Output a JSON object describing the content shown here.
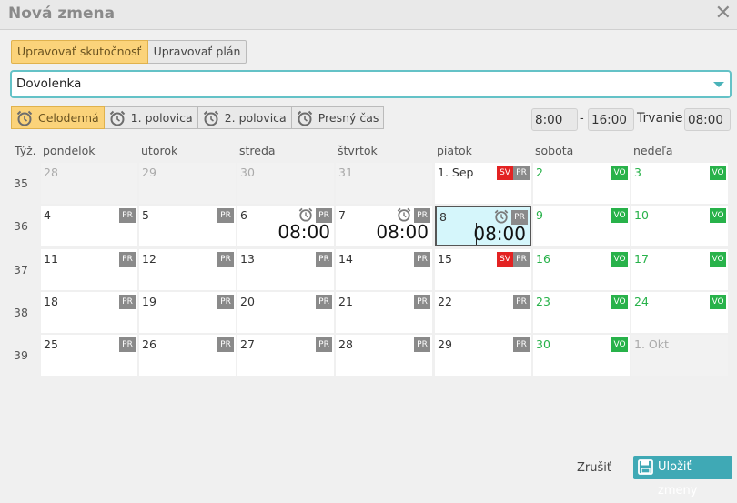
{
  "dialog": {
    "title": "Nová zmena"
  },
  "tabs": [
    {
      "label": "Upravovať skutočnosť",
      "active": true
    },
    {
      "label": "Upravovať plán",
      "active": false
    }
  ],
  "shift_type": {
    "value": "Dovolenka"
  },
  "modes": [
    {
      "label": "Celodenná",
      "active": true
    },
    {
      "label": "1. polovica",
      "active": false
    },
    {
      "label": "2. polovica",
      "active": false
    },
    {
      "label": "Presný čas",
      "active": false
    }
  ],
  "time": {
    "start": "8:00",
    "separator": "-",
    "end": "16:00",
    "duration_label": "Trvanie",
    "duration": "08:00"
  },
  "calendar": {
    "week_header": "Týž.",
    "day_headers": [
      "pondelok",
      "utorok",
      "streda",
      "štvrtok",
      "piatok",
      "sobota",
      "nedeľa"
    ],
    "weeks": [
      {
        "num": "35",
        "days": [
          {
            "d": "28",
            "type": "other"
          },
          {
            "d": "29",
            "type": "other"
          },
          {
            "d": "30",
            "type": "other"
          },
          {
            "d": "31",
            "type": "other"
          },
          {
            "d": "1. Sep",
            "badges": [
              "SV",
              "PR"
            ]
          },
          {
            "d": "2",
            "type": "weekend",
            "badges": [
              "VO"
            ]
          },
          {
            "d": "3",
            "type": "weekend",
            "badges": [
              "VO"
            ]
          }
        ]
      },
      {
        "num": "36",
        "days": [
          {
            "d": "4",
            "badges": [
              "PR"
            ]
          },
          {
            "d": "5",
            "badges": [
              "PR"
            ]
          },
          {
            "d": "6",
            "badges": [
              "PR"
            ],
            "clock": true,
            "time": "08:00"
          },
          {
            "d": "7",
            "badges": [
              "PR"
            ],
            "clock": true,
            "time": "08:00"
          },
          {
            "d": "8",
            "badges": [
              "PR"
            ],
            "clock": true,
            "time": "08:00",
            "selected": true
          },
          {
            "d": "9",
            "type": "weekend",
            "badges": [
              "VO"
            ]
          },
          {
            "d": "10",
            "type": "weekend",
            "badges": [
              "VO"
            ]
          }
        ]
      },
      {
        "num": "37",
        "days": [
          {
            "d": "11",
            "badges": [
              "PR"
            ]
          },
          {
            "d": "12",
            "badges": [
              "PR"
            ]
          },
          {
            "d": "13",
            "badges": [
              "PR"
            ]
          },
          {
            "d": "14",
            "badges": [
              "PR"
            ]
          },
          {
            "d": "15",
            "badges": [
              "SV",
              "PR"
            ]
          },
          {
            "d": "16",
            "type": "weekend",
            "badges": [
              "VO"
            ]
          },
          {
            "d": "17",
            "type": "weekend",
            "badges": [
              "VO"
            ]
          }
        ]
      },
      {
        "num": "38",
        "days": [
          {
            "d": "18",
            "badges": [
              "PR"
            ]
          },
          {
            "d": "19",
            "badges": [
              "PR"
            ]
          },
          {
            "d": "20",
            "badges": [
              "PR"
            ]
          },
          {
            "d": "21",
            "badges": [
              "PR"
            ]
          },
          {
            "d": "22",
            "badges": [
              "PR"
            ]
          },
          {
            "d": "23",
            "type": "weekend",
            "badges": [
              "VO"
            ]
          },
          {
            "d": "24",
            "type": "weekend",
            "badges": [
              "VO"
            ]
          }
        ]
      },
      {
        "num": "39",
        "days": [
          {
            "d": "25",
            "badges": [
              "PR"
            ]
          },
          {
            "d": "26",
            "badges": [
              "PR"
            ]
          },
          {
            "d": "27",
            "badges": [
              "PR"
            ]
          },
          {
            "d": "28",
            "badges": [
              "PR"
            ]
          },
          {
            "d": "29",
            "badges": [
              "PR"
            ]
          },
          {
            "d": "30",
            "type": "weekend",
            "badges": [
              "VO"
            ]
          },
          {
            "d": "1. Okt",
            "type": "other"
          }
        ]
      }
    ]
  },
  "footer": {
    "cancel": "Zrušiť",
    "save": "Uložiť zmeny"
  },
  "icons": {
    "close": "close-icon",
    "alarm": "alarm-clock-icon",
    "save": "floppy-disk-icon",
    "dropdown": "chevron-down-icon"
  },
  "colors": {
    "accent": "#3fa9b5",
    "active_tab": "#fbd37a",
    "weekend": "#28b24a",
    "holiday": "#e32222",
    "selected_day": "#d5f6fb"
  }
}
